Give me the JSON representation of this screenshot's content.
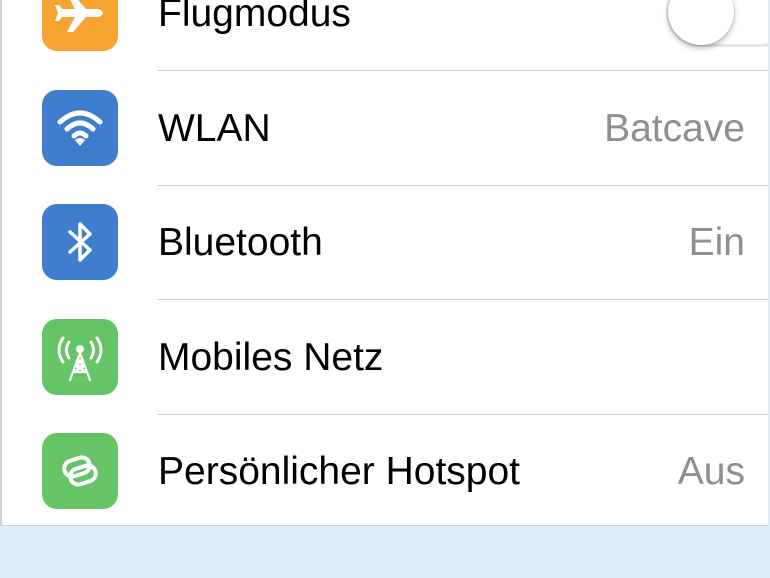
{
  "colors": {
    "airplane": "#f7a530",
    "wifi": "#3f7ecf",
    "bluetooth": "#3f7ecf",
    "cellular": "#65c466",
    "hotspot": "#65c466",
    "value_text": "#8e8e93",
    "background": "#e0eef9"
  },
  "rows": [
    {
      "label": "Flugmodus",
      "icon": "airplane-icon",
      "toggle_on": false
    },
    {
      "label": "WLAN",
      "icon": "wifi-icon",
      "value": "Batcave"
    },
    {
      "label": "Bluetooth",
      "icon": "bluetooth-icon",
      "value": "Ein"
    },
    {
      "label": "Mobiles Netz",
      "icon": "cellular-antenna-icon"
    },
    {
      "label": "Persönlicher Hotspot",
      "icon": "hotspot-icon",
      "value": "Aus"
    }
  ]
}
